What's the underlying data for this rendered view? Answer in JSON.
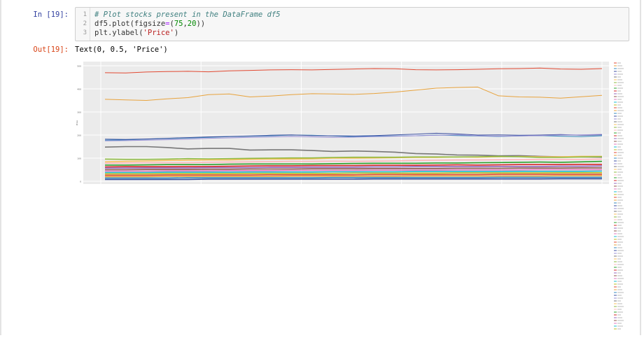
{
  "cell": {
    "in_prompt": "In [19]:",
    "out_prompt": "Out[19]:",
    "line_numbers": [
      "1",
      "2",
      "3"
    ],
    "code": {
      "line1_comment": "# Plot stocks present in the DataFrame df5",
      "line2_a": "df5.plot(figsize",
      "line2_eq": "=",
      "line2_b": "(",
      "line2_n1": "75",
      "line2_comma": ",",
      "line2_n2": "20",
      "line2_c": "))",
      "line3_a": "plt.ylabel(",
      "line3_str": "'Price'",
      "line3_b": ")"
    },
    "output_text": "Text(0, 0.5, 'Price')"
  },
  "colors": {
    "plot_bg": "#ebebeb",
    "grid": "#ffffff",
    "series_palette": [
      "#e24a33",
      "#e8a33d",
      "#348abd",
      "#3b4fa0",
      "#988ed5",
      "#777777",
      "#fbc15e",
      "#8eba42",
      "#ffb5b8",
      "#2ca02c",
      "#d62728",
      "#9467bd",
      "#8c564b",
      "#e377c2",
      "#17becf",
      "#bcbd22"
    ]
  },
  "chart_data": {
    "type": "line",
    "title": "",
    "xlabel": "",
    "ylabel": "Price",
    "grid": true,
    "legend": "right",
    "ylim": [
      0,
      500
    ],
    "yticks": [
      "0",
      "100",
      "200",
      "300",
      "400",
      "500"
    ],
    "series": [
      {
        "values": [
          470,
          469,
          473,
          475,
          476,
          474,
          478,
          480,
          482,
          483,
          482,
          484,
          486,
          488,
          487,
          483,
          482,
          483,
          485,
          487,
          488,
          490,
          486,
          485,
          488
        ]
      },
      {
        "values": [
          355,
          352,
          350,
          357,
          362,
          375,
          378,
          365,
          369,
          375,
          379,
          378,
          376,
          380,
          386,
          395,
          403,
          406,
          408,
          370,
          365,
          364,
          360,
          366,
          372
        ]
      },
      {
        "values": [
          178,
          179,
          182,
          185,
          187,
          190,
          193,
          195,
          197,
          200,
          199,
          196,
          193,
          195,
          196,
          197,
          200,
          198,
          196,
          194,
          196,
          198,
          195,
          193,
          197
        ]
      },
      {
        "values": [
          182,
          181,
          183,
          186,
          189,
          192,
          194,
          196,
          199,
          201,
          198,
          197,
          196,
          198,
          201,
          204,
          208,
          205,
          200,
          201,
          199,
          200,
          202,
          199,
          201
        ]
      },
      {
        "values": [
          175,
          176,
          178,
          180,
          182,
          186,
          188,
          190,
          192,
          194,
          192,
          190,
          191,
          193,
          195,
          197,
          199,
          201,
          197,
          195,
          196,
          198,
          200,
          201,
          203
        ]
      },
      {
        "values": [
          148,
          150,
          150,
          146,
          140,
          142,
          142,
          135,
          136,
          136,
          133,
          129,
          131,
          129,
          126,
          120,
          118,
          114,
          113,
          110,
          111,
          108,
          106,
          105,
          104
        ]
      },
      {
        "values": [
          84,
          86,
          88,
          90,
          91,
          92,
          92,
          95,
          96,
          96,
          97,
          100,
          100,
          101,
          102,
          103,
          103,
          105,
          104,
          106,
          107,
          106,
          106,
          108,
          108
        ]
      },
      {
        "values": [
          96,
          95,
          95,
          96,
          98,
          97,
          98,
          99,
          100,
          101,
          101,
          103,
          104,
          104,
          104,
          105,
          105,
          105,
          106,
          108,
          106,
          103,
          103,
          105,
          106
        ]
      },
      {
        "values": [
          78,
          79,
          80,
          80,
          80,
          82,
          83,
          84,
          85,
          86,
          86,
          87,
          86,
          87,
          88,
          90,
          91,
          92,
          92,
          93,
          94,
          95,
          95,
          95,
          96
        ]
      },
      {
        "values": [
          70,
          70,
          71,
          72,
          72,
          72,
          74,
          75,
          75,
          75,
          75,
          76,
          77,
          78,
          78,
          78,
          79,
          79,
          80,
          81,
          82,
          83,
          82,
          84,
          86
        ]
      },
      {
        "values": [
          62,
          63,
          63,
          63,
          64,
          64,
          65,
          66,
          67,
          67,
          68,
          68,
          68,
          69,
          69,
          69,
          70,
          71,
          70,
          71,
          72,
          72,
          72,
          73,
          73
        ]
      },
      {
        "values": [
          57,
          57,
          58,
          58,
          58,
          59,
          59,
          59,
          60,
          60,
          61,
          61,
          61,
          62,
          62,
          63,
          63,
          63,
          63,
          64,
          64,
          64,
          65,
          65,
          66
        ]
      },
      {
        "values": [
          50,
          50,
          51,
          51,
          51,
          52,
          52,
          53,
          53,
          53,
          54,
          54,
          54,
          55,
          55,
          55,
          55,
          56,
          56,
          56,
          57,
          57,
          57,
          58,
          58
        ]
      },
      {
        "values": [
          44,
          44,
          44,
          45,
          45,
          45,
          46,
          46,
          46,
          47,
          47,
          47,
          47,
          48,
          48,
          48,
          48,
          49,
          49,
          49,
          49,
          50,
          50,
          50,
          50
        ]
      },
      {
        "values": [
          38,
          38,
          38,
          39,
          39,
          39,
          39,
          40,
          40,
          40,
          40,
          41,
          41,
          41,
          41,
          42,
          42,
          42,
          42,
          42,
          43,
          43,
          43,
          43,
          44
        ]
      },
      {
        "values": [
          32,
          32,
          32,
          33,
          33,
          33,
          33,
          34,
          34,
          34,
          34,
          34,
          35,
          35,
          35,
          35,
          35,
          36,
          36,
          36,
          36,
          36,
          37,
          37,
          37
        ]
      },
      {
        "values": [
          26,
          26,
          26,
          27,
          27,
          27,
          27,
          27,
          28,
          28,
          28,
          28,
          28,
          29,
          29,
          29,
          29,
          29,
          29,
          30,
          30,
          30,
          30,
          30,
          30
        ]
      },
      {
        "values": [
          20,
          20,
          20,
          21,
          21,
          21,
          21,
          21,
          21,
          22,
          22,
          22,
          22,
          22,
          22,
          23,
          23,
          23,
          23,
          23,
          23,
          23,
          24,
          24,
          24
        ]
      },
      {
        "values": [
          14,
          14,
          14,
          14,
          15,
          15,
          15,
          15,
          15,
          15,
          15,
          16,
          16,
          16,
          16,
          16,
          16,
          16,
          16,
          17,
          17,
          17,
          17,
          17,
          17
        ]
      },
      {
        "values": [
          8,
          8,
          8,
          8,
          8,
          9,
          9,
          9,
          9,
          9,
          9,
          9,
          9,
          10,
          10,
          10,
          10,
          10,
          10,
          10,
          10,
          10,
          11,
          11,
          11
        ]
      }
    ]
  }
}
